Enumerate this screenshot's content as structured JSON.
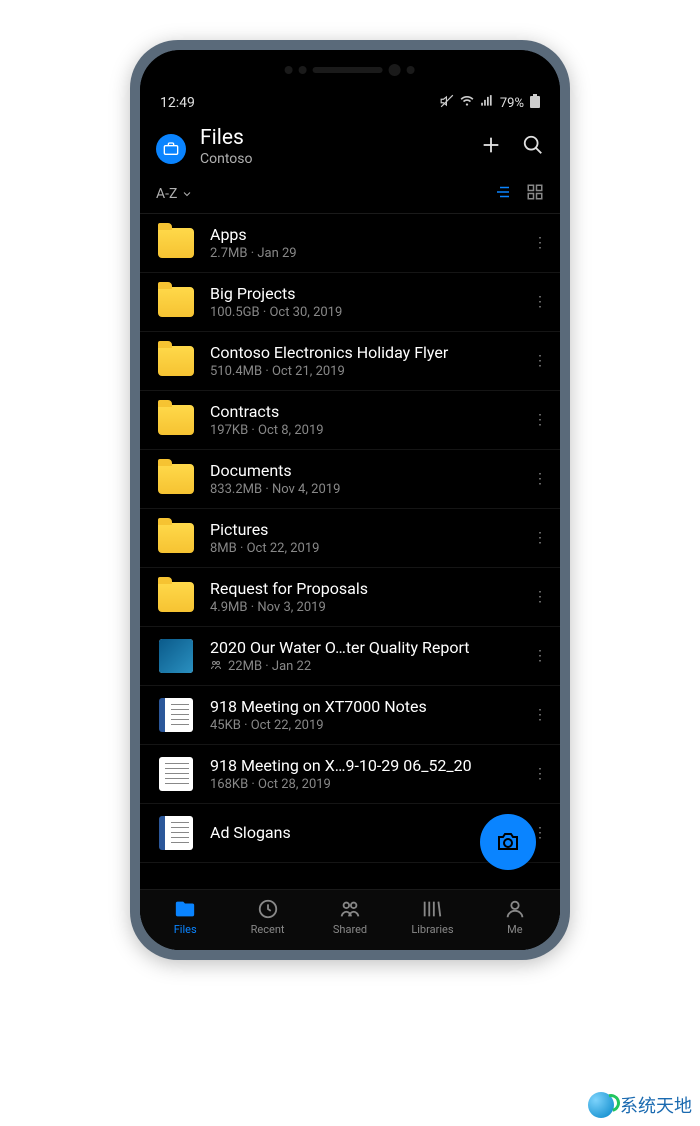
{
  "status": {
    "time": "12:49",
    "battery_label": "79%"
  },
  "header": {
    "title": "Files",
    "subtitle": "Contoso"
  },
  "controls": {
    "sort_label": "A-Z"
  },
  "files": [
    {
      "name": "Apps",
      "meta": "2.7MB · Jan 29",
      "type": "folder"
    },
    {
      "name": "Big Projects",
      "meta": "100.5GB · Oct 30, 2019",
      "type": "folder"
    },
    {
      "name": "Contoso Electronics Holiday Flyer",
      "meta": "510.4MB · Oct 21, 2019",
      "type": "folder"
    },
    {
      "name": "Contracts",
      "meta": "197KB · Oct 8, 2019",
      "type": "folder"
    },
    {
      "name": "Documents",
      "meta": "833.2MB · Nov 4, 2019",
      "type": "folder"
    },
    {
      "name": "Pictures",
      "meta": "8MB · Oct 22, 2019",
      "type": "folder"
    },
    {
      "name": "Request for Proposals",
      "meta": "4.9MB · Nov 3, 2019",
      "type": "folder"
    },
    {
      "name": "2020 Our Water O…ter Quality Report",
      "meta": "22MB · Jan 22",
      "type": "image",
      "shared": true
    },
    {
      "name": "918 Meeting on XT7000 Notes",
      "meta": "45KB · Oct 22, 2019",
      "type": "word"
    },
    {
      "name": "918 Meeting on X…9-10-29 06_52_20",
      "meta": "168KB · Oct 28, 2019",
      "type": "plain"
    },
    {
      "name": "Ad Slogans",
      "meta": "",
      "type": "word"
    }
  ],
  "nav": {
    "files": "Files",
    "recent": "Recent",
    "shared": "Shared",
    "libraries": "Libraries",
    "me": "Me"
  },
  "watermark": "系统天地"
}
